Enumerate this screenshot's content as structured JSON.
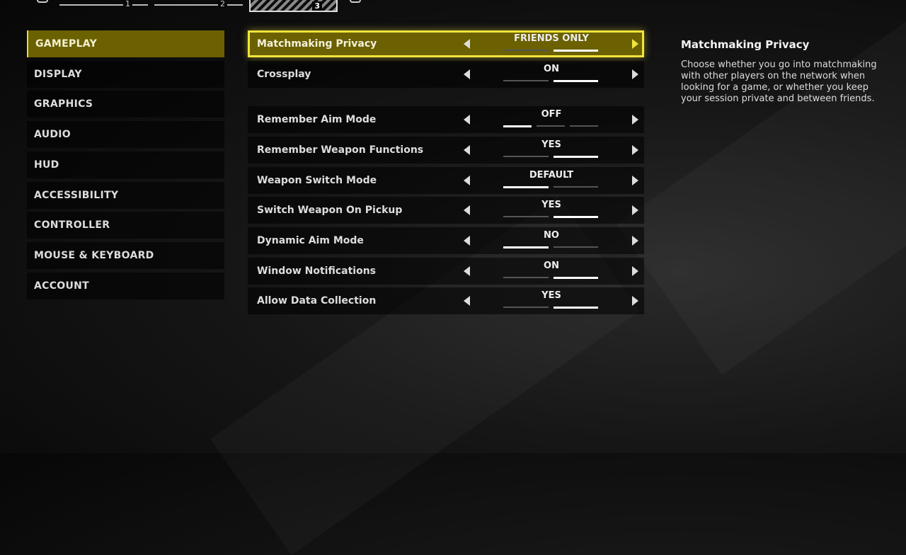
{
  "top_tabs": [
    {
      "label": "1",
      "active": false
    },
    {
      "label": "2",
      "active": false
    },
    {
      "label": "3",
      "active": true
    }
  ],
  "categories": [
    {
      "label": "GAMEPLAY",
      "active": true
    },
    {
      "label": "DISPLAY"
    },
    {
      "label": "GRAPHICS"
    },
    {
      "label": "AUDIO"
    },
    {
      "label": "HUD"
    },
    {
      "label": "ACCESSIBILITY"
    },
    {
      "label": "CONTROLLER"
    },
    {
      "label": "MOUSE & KEYBOARD"
    },
    {
      "label": "ACCOUNT"
    }
  ],
  "settings": [
    {
      "label": "Matchmaking Privacy",
      "value": "FRIENDS ONLY",
      "segments": 2,
      "selected": 1,
      "active": true
    },
    {
      "label": "Crossplay",
      "value": "ON",
      "segments": 2,
      "selected": 1
    },
    {
      "label": "Remember Aim Mode",
      "value": "OFF",
      "segments": 3,
      "selected": 0
    },
    {
      "label": "Remember Weapon Functions",
      "value": "YES",
      "segments": 2,
      "selected": 1
    },
    {
      "label": "Weapon Switch Mode",
      "value": "DEFAULT",
      "segments": 2,
      "selected": 0
    },
    {
      "label": "Switch Weapon On Pickup",
      "value": "YES",
      "segments": 2,
      "selected": 1
    },
    {
      "label": "Dynamic Aim Mode",
      "value": "NO",
      "segments": 2,
      "selected": 0
    },
    {
      "label": "Window Notifications",
      "value": "ON",
      "segments": 2,
      "selected": 1
    },
    {
      "label": "Allow Data Collection",
      "value": "YES",
      "segments": 2,
      "selected": 1
    }
  ],
  "description": {
    "title": "Matchmaking Privacy",
    "text": "Choose whether you go into matchmaking with other players on the network when looking for a game, or whether you keep your session private and between friends."
  },
  "colors": {
    "accent": "#f2e43a",
    "active_bg": "#6b6100"
  }
}
